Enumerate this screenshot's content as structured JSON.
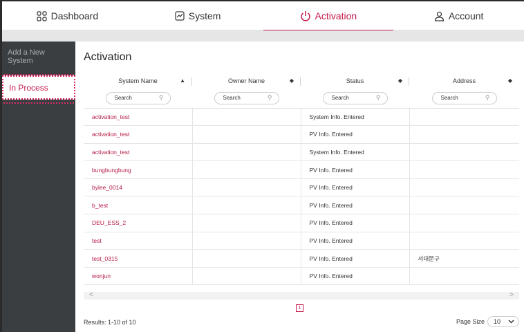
{
  "nav": {
    "tabs": [
      {
        "label": "Dashboard",
        "icon": "dashboard-grid-icon"
      },
      {
        "label": "System",
        "icon": "system-chart-icon"
      },
      {
        "label": "Activation",
        "icon": "power-icon",
        "active": true
      },
      {
        "label": "Account",
        "icon": "user-icon"
      }
    ],
    "accent": "#c7194b"
  },
  "sidebar": {
    "items": [
      {
        "label": "Add a New System"
      },
      {
        "label": "In Process",
        "active": true
      }
    ]
  },
  "main": {
    "title": "Activation",
    "columns": [
      {
        "label": "System Name",
        "sort": "▲"
      },
      {
        "label": "Owner Name",
        "sort": "◆"
      },
      {
        "label": "Status",
        "sort": "◆"
      },
      {
        "label": "Address",
        "sort": "◆"
      }
    ],
    "search_placeholder": "Search",
    "rows": [
      {
        "name": "activation_test",
        "owner": "",
        "status": "System Info. Entered",
        "address": ""
      },
      {
        "name": "activation_test",
        "owner": "",
        "status": "PV Info. Entered",
        "address": ""
      },
      {
        "name": "activation_test",
        "owner": "",
        "status": "System Info. Entered",
        "address": ""
      },
      {
        "name": "bungbungbung",
        "owner": "",
        "status": "PV Info. Entered",
        "address": ""
      },
      {
        "name": "bylee_0014",
        "owner": "",
        "status": "PV Info. Entered",
        "address": ""
      },
      {
        "name": "b_test",
        "owner": "",
        "status": "PV Info. Entered",
        "address": ""
      },
      {
        "name": "DEU_ESS_2",
        "owner": "",
        "status": "PV Info. Entered",
        "address": ""
      },
      {
        "name": "test",
        "owner": "",
        "status": "PV Info. Entered",
        "address": ""
      },
      {
        "name": "test_0315",
        "owner": "",
        "status": "PV Info. Entered",
        "address": "서대문구"
      },
      {
        "name": "wonjun",
        "owner": "",
        "status": "PV Info. Entered",
        "address": ""
      }
    ],
    "page": "1",
    "results": "Results: 1-10 of 10",
    "page_size_label": "Page Size",
    "page_size_value": "10"
  }
}
